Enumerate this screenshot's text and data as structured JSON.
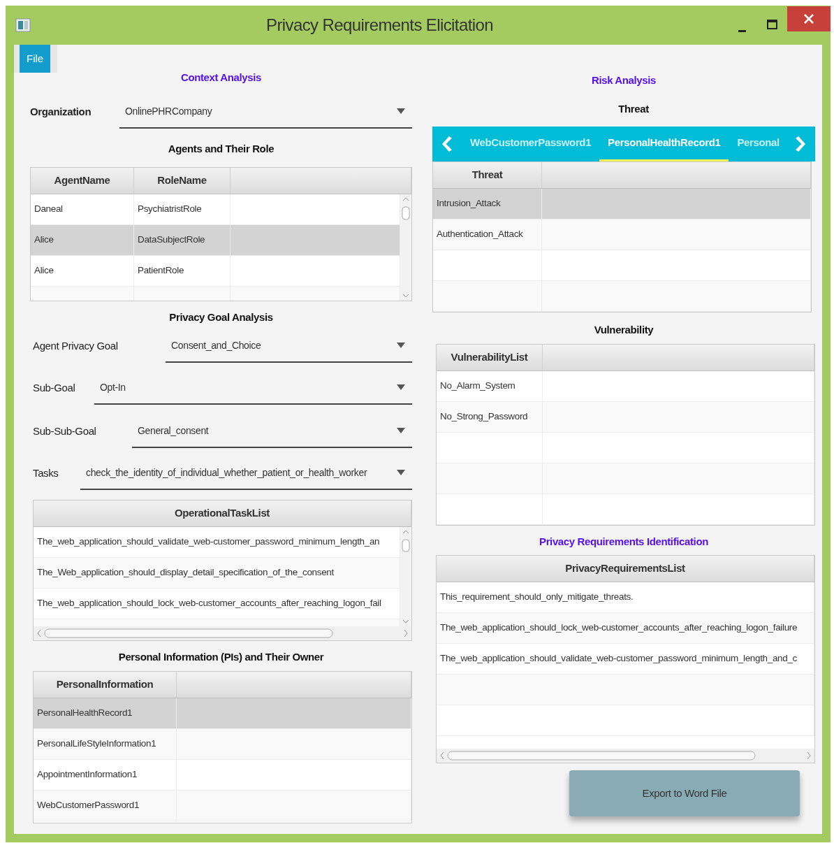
{
  "window": {
    "title": "Privacy Requirements Elicitation"
  },
  "menu": [
    {
      "label": "File",
      "selected": true
    }
  ],
  "context_analysis": {
    "heading": "Context Analysis",
    "organization": {
      "label": "Organization",
      "value": "OnlinePHRCompany"
    },
    "agents_heading": "Agents and Their Role",
    "agents_table": {
      "columns": [
        "AgentName",
        "RoleName"
      ],
      "rows": [
        {
          "cells": [
            "Daneal",
            "PsychiatristRole"
          ],
          "selected": false
        },
        {
          "cells": [
            "Alice",
            "DataSubjectRole"
          ],
          "selected": true
        },
        {
          "cells": [
            "Alice",
            "PatientRole"
          ],
          "selected": false
        }
      ]
    }
  },
  "privacy_goal_analysis": {
    "heading": "Privacy Goal Analysis",
    "fields": [
      {
        "label": "Agent Privacy Goal",
        "value": "Consent_and_Choice"
      },
      {
        "label": "Sub-Goal",
        "value": "Opt-In"
      },
      {
        "label": "Sub-Sub-Goal",
        "value": "General_consent"
      },
      {
        "label": "Tasks",
        "value": "check_the_identity_of_individual_whether_patient_or_health_worker"
      }
    ],
    "operational_tasks": {
      "columns": [
        "OperationalTaskList"
      ],
      "rows": [
        {
          "cells": [
            "The_web_application_should_validate_web-customer_password_minimum_length_an"
          ]
        },
        {
          "cells": [
            "The_Web_application_should_display_detail_specification_of_the_consent"
          ]
        },
        {
          "cells": [
            "The_web_application_should_lock_web-customer_accounts_after_reaching_logon_fail"
          ]
        }
      ]
    }
  },
  "personal_information": {
    "heading": "Personal Information (PIs) and Their Owner",
    "table": {
      "columns": [
        "PersonalInformation"
      ],
      "rows": [
        {
          "cells": [
            "PersonalHealthRecord1"
          ],
          "selected": true
        },
        {
          "cells": [
            "PersonalLifeStyleInformation1"
          ],
          "selected": false
        },
        {
          "cells": [
            "AppointmentInformation1"
          ],
          "selected": false
        },
        {
          "cells": [
            "WebCustomerPassword1"
          ],
          "selected": false
        }
      ]
    }
  },
  "risk_analysis": {
    "heading": "Risk Analysis",
    "threat_heading": "Threat",
    "tabs": [
      {
        "label": "WebCustomerPassword1",
        "selected": false
      },
      {
        "label": "PersonalHealthRecord1",
        "selected": true
      },
      {
        "label": "Personal",
        "selected": false
      }
    ],
    "threat_table": {
      "columns": [
        "Threat"
      ],
      "rows": [
        {
          "cells": [
            "Intrusion_Attack"
          ],
          "selected": true
        },
        {
          "cells": [
            "Authentication_Attack"
          ],
          "selected": false
        }
      ]
    }
  },
  "vulnerability": {
    "heading": "Vulnerability",
    "table": {
      "columns": [
        "VulnerabilityList"
      ],
      "rows": [
        {
          "cells": [
            "No_Alarm_System"
          ]
        },
        {
          "cells": [
            "No_Strong_Password"
          ]
        }
      ]
    }
  },
  "privacy_requirements": {
    "heading": "Privacy Requirements Identification",
    "table": {
      "columns": [
        "PrivacyRequirementsList"
      ],
      "rows": [
        {
          "cells": [
            "This_requirement_should_only_mitigate_threats."
          ]
        },
        {
          "cells": [
            "The_web_application_should_lock_web-customer_accounts_after_reaching_logon_failure"
          ]
        },
        {
          "cells": [
            "The_web_application_should_validate_web-customer_password_minimum_length_and_c"
          ]
        }
      ]
    }
  },
  "export_button": {
    "label": "Export to Word File"
  }
}
